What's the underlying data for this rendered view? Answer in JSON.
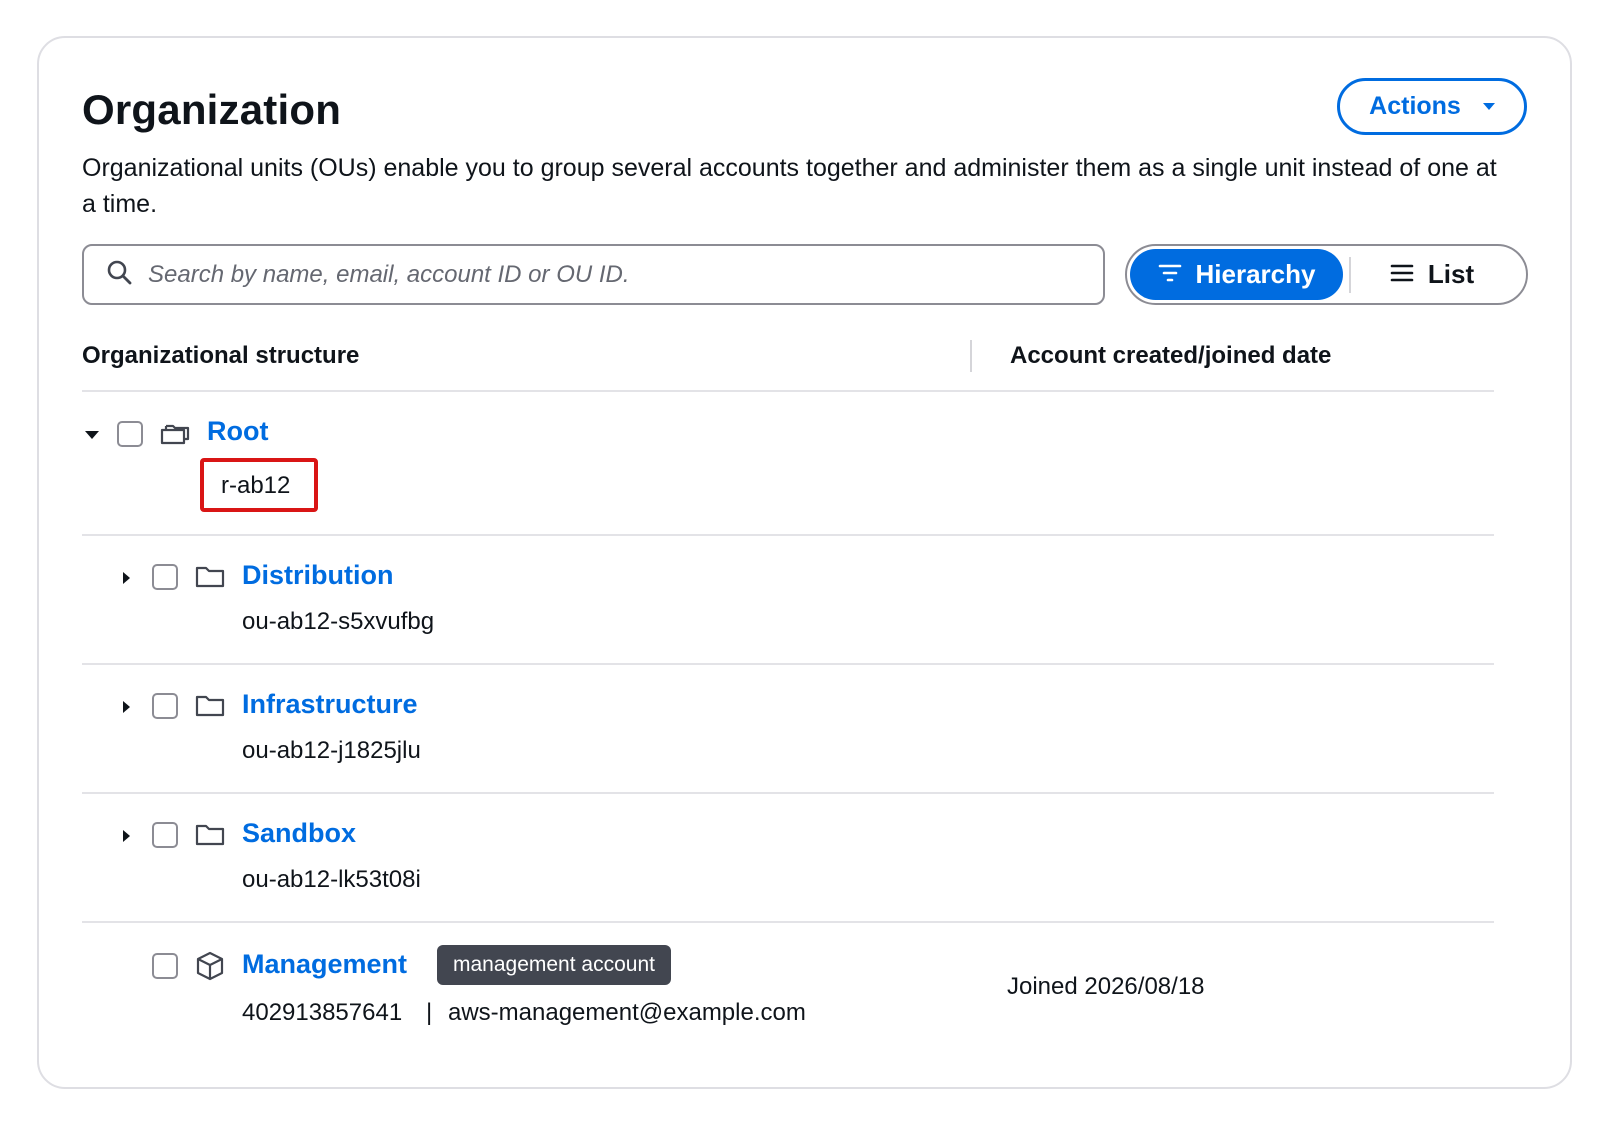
{
  "header": {
    "title": "Organization",
    "actions_label": "Actions",
    "description": "Organizational units (OUs) enable you to group several accounts together and administer them as a single unit instead of one at a time."
  },
  "search": {
    "placeholder": "Search by name, email, account ID or OU ID."
  },
  "view_toggle": {
    "hierarchy_label": "Hierarchy",
    "list_label": "List",
    "selected": "Hierarchy"
  },
  "table": {
    "columns": [
      "Organizational structure",
      "Account created/joined date"
    ]
  },
  "root": {
    "name": "Root",
    "id": "r-ab12",
    "expanded": true
  },
  "ous": [
    {
      "name": "Distribution",
      "id": "ou-ab12-s5xvufbg"
    },
    {
      "name": "Infrastructure",
      "id": "ou-ab12-j1825jlu"
    },
    {
      "name": "Sandbox",
      "id": "ou-ab12-lk53t08i"
    }
  ],
  "management": {
    "name": "Management",
    "badge": "management account",
    "account_id": "402913857641",
    "separator": "|",
    "email": "aws-management@example.com",
    "joined": "Joined 2026/08/18"
  },
  "colors": {
    "link": "#006ce0",
    "highlight": "#d91515",
    "badge_bg": "#424650"
  },
  "icons": [
    "search-icon",
    "filter-icon",
    "list-icon",
    "chevron-down-icon",
    "chevron-right-icon",
    "folder-icon",
    "root-folder-icon",
    "account-cube-icon",
    "caret-down-icon"
  ]
}
